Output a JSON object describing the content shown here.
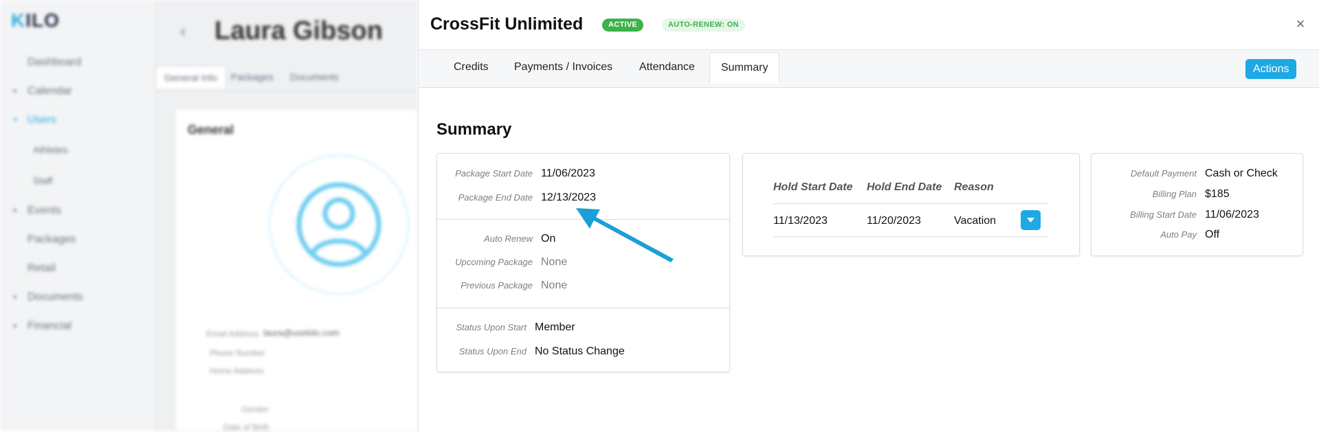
{
  "background": {
    "logo": "KILO",
    "nav": [
      {
        "label": "Dashboard",
        "caret": false,
        "sub": false,
        "active": false
      },
      {
        "label": "Calendar",
        "caret": true,
        "sub": false,
        "active": false
      },
      {
        "label": "Users",
        "caret": true,
        "sub": false,
        "active": true
      },
      {
        "label": "Athletes",
        "caret": false,
        "sub": true,
        "active": false
      },
      {
        "label": "Staff",
        "caret": false,
        "sub": true,
        "active": false
      },
      {
        "label": "Events",
        "caret": true,
        "sub": false,
        "active": false
      },
      {
        "label": "Packages",
        "caret": false,
        "sub": false,
        "active": false
      },
      {
        "label": "Retail",
        "caret": false,
        "sub": false,
        "active": false
      },
      {
        "label": "Documents",
        "caret": true,
        "sub": false,
        "active": false
      },
      {
        "label": "Financial",
        "caret": true,
        "sub": false,
        "active": false
      }
    ],
    "page_title": "Laura Gibson",
    "tabs": [
      "General Info",
      "Packages",
      "Documents"
    ],
    "card_title": "General",
    "fields": [
      {
        "label": "Email Address",
        "value": "laura@usekilo.com"
      },
      {
        "label": "Phone Number",
        "value": ""
      },
      {
        "label": "Home Address",
        "value": ""
      },
      {
        "label": "Gender",
        "value": ""
      },
      {
        "label": "Date of Birth",
        "value": ""
      }
    ]
  },
  "panel": {
    "title": "CrossFit Unlimited",
    "badge_active": "ACTIVE",
    "badge_renew": "AUTO-RENEW: ON",
    "close_icon": "close-icon",
    "tabs": [
      "Credits",
      "Payments / Invoices",
      "Attendance",
      "Summary"
    ],
    "active_tab": "Summary",
    "actions_label": "Actions",
    "section_title": "Summary",
    "package_dates": {
      "start_label": "Package Start Date",
      "start_value": "11/06/2023",
      "end_label": "Package End Date",
      "end_value": "12/13/2023"
    },
    "package_info": {
      "auto_renew_label": "Auto Renew",
      "auto_renew_value": "On",
      "upcoming_label": "Upcoming Package",
      "upcoming_value": "None",
      "previous_label": "Previous Package",
      "previous_value": "None"
    },
    "status_info": {
      "start_label": "Status Upon Start",
      "start_value": "Member",
      "end_label": "Status Upon End",
      "end_value": "No Status Change"
    },
    "holds": {
      "headers": [
        "Hold Start Date",
        "Hold End Date",
        "Reason"
      ],
      "rows": [
        {
          "start": "11/13/2023",
          "end": "11/20/2023",
          "reason": "Vacation"
        }
      ]
    },
    "billing": {
      "default_payment_label": "Default Payment",
      "default_payment_value": "Cash or Check",
      "plan_label": "Billing Plan",
      "plan_value": "$185",
      "start_label": "Billing Start Date",
      "start_value": "11/06/2023",
      "autopay_label": "Auto Pay",
      "autopay_value": "Off"
    }
  },
  "colors": {
    "accent": "#1ea8e6",
    "active_badge": "#3cb34a",
    "renew_badge_bg": "#e6f6e8",
    "annotation_arrow": "#1b9fd6"
  }
}
